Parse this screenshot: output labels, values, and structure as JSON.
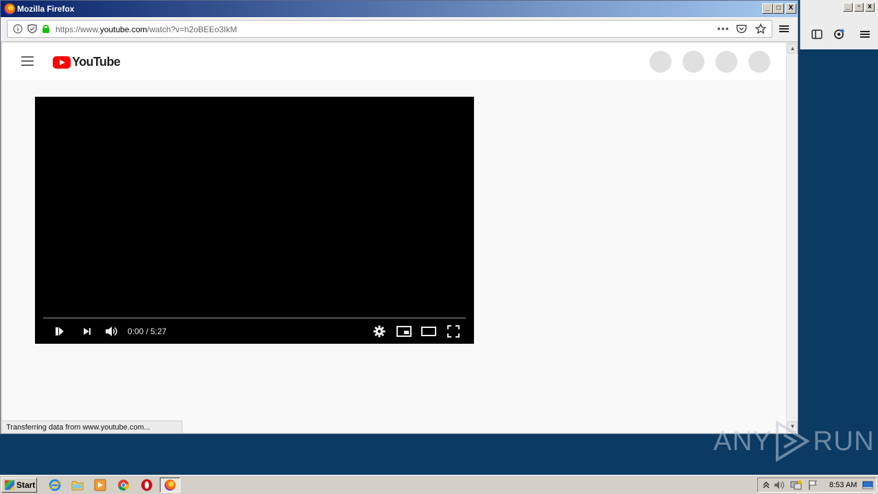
{
  "window": {
    "title": "Mozilla Firefox",
    "controls": {
      "minimize": "_",
      "maximize": "□",
      "close": "X"
    }
  },
  "navbar": {
    "url_prefix": "https://www.",
    "url_domain": "youtube.com",
    "url_path": "/watch?v=h2oBEEo3IkM",
    "icons": [
      "info-icon",
      "tracking-protection-icon",
      "lock-icon",
      "page-actions-icon",
      "pocket-icon",
      "bookmark-star-icon",
      "menu-icon"
    ]
  },
  "youtube": {
    "logo_text": "YouTube",
    "player": {
      "time_display": "0:00 / 5:27",
      "progress": 0.0
    }
  },
  "status": {
    "text": "Transferring data from www.youtube.com..."
  },
  "watermark": {
    "left": "ANY",
    "right": "RUN"
  },
  "taskbar": {
    "start_label": "Start",
    "clock": "8:53 AM",
    "apps": [
      "internet-explorer-icon",
      "explorer-folder-icon",
      "media-player-icon",
      "chrome-icon",
      "opera-icon",
      "firefox-icon"
    ]
  },
  "colors": {
    "youtube_red": "#ff0000",
    "titlebar_start": "#0a246a",
    "titlebar_end": "#a6caf0",
    "desktop": "#0b3a63",
    "lock_green": "#12bc00"
  }
}
